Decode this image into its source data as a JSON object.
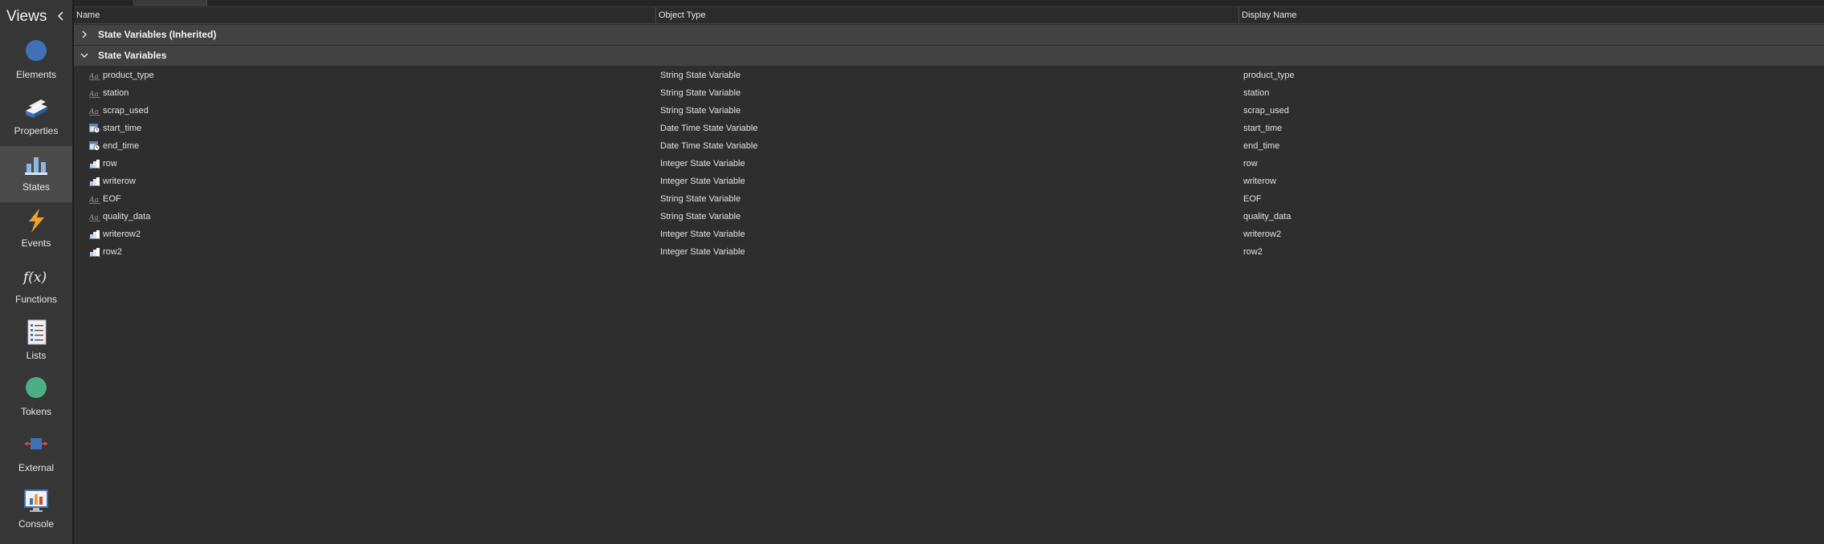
{
  "sidebar": {
    "title": "Views",
    "items": [
      {
        "label": "Elements",
        "icon": "elements-icon"
      },
      {
        "label": "Properties",
        "icon": "properties-icon"
      },
      {
        "label": "States",
        "icon": "states-icon",
        "active": true
      },
      {
        "label": "Events",
        "icon": "events-icon"
      },
      {
        "label": "Functions",
        "icon": "functions-icon"
      },
      {
        "label": "Lists",
        "icon": "lists-icon"
      },
      {
        "label": "Tokens",
        "icon": "tokens-icon"
      },
      {
        "label": "External",
        "icon": "external-icon"
      },
      {
        "label": "Console",
        "icon": "console-icon"
      }
    ]
  },
  "grid": {
    "columns": [
      "Name",
      "Object Type",
      "Display Name"
    ],
    "groups": [
      {
        "label": "State Variables (Inherited)",
        "expanded": false
      },
      {
        "label": "State Variables",
        "expanded": true
      }
    ],
    "rows": [
      {
        "name": "product_type",
        "type": "String State Variable",
        "display": "product_type",
        "icon": "string-variable-icon"
      },
      {
        "name": "station",
        "type": "String State Variable",
        "display": "station",
        "icon": "string-variable-icon"
      },
      {
        "name": "scrap_used",
        "type": "String State Variable",
        "display": "scrap_used",
        "icon": "string-variable-icon"
      },
      {
        "name": "start_time",
        "type": "Date Time State Variable",
        "display": "start_time",
        "icon": "datetime-variable-icon"
      },
      {
        "name": "end_time",
        "type": "Date Time State Variable",
        "display": "end_time",
        "icon": "datetime-variable-icon"
      },
      {
        "name": "row",
        "type": "Integer State Variable",
        "display": "row",
        "icon": "integer-variable-icon"
      },
      {
        "name": "writerow",
        "type": "Integer State Variable",
        "display": "writerow",
        "icon": "integer-variable-icon"
      },
      {
        "name": "EOF",
        "type": "String State Variable",
        "display": "EOF",
        "icon": "string-variable-icon"
      },
      {
        "name": "quality_data",
        "type": "String State Variable",
        "display": "quality_data",
        "icon": "string-variable-icon"
      },
      {
        "name": "writerow2",
        "type": "Integer State Variable",
        "display": "writerow2",
        "icon": "integer-variable-icon"
      },
      {
        "name": "row2",
        "type": "Integer State Variable",
        "display": "row2",
        "icon": "integer-variable-icon"
      }
    ]
  },
  "colors": {
    "accent_blue": "#3f72b5",
    "token_green": "#4caf84",
    "event_orange": "#f0a030",
    "external_red": "#d9443a"
  }
}
